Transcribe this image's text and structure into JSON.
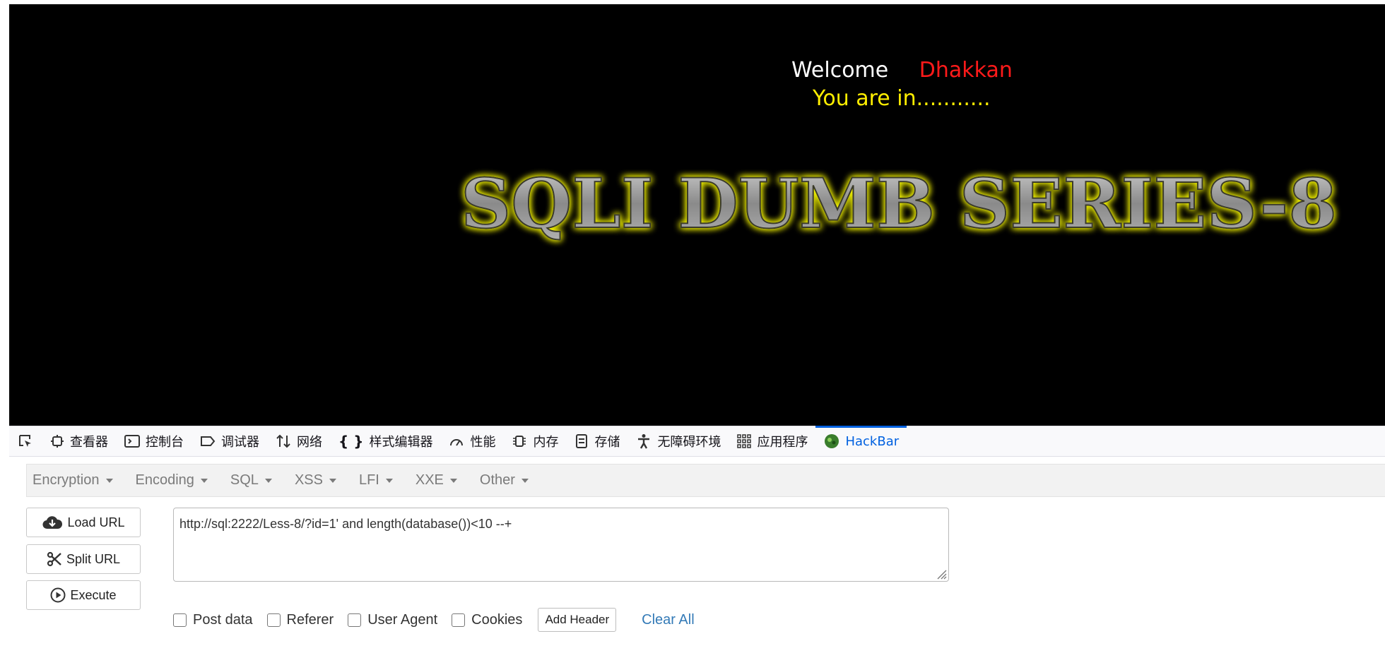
{
  "page": {
    "welcome_word": "Welcome",
    "welcome_name": "Dhakkan",
    "status_message": "You are in...........",
    "banner_text": "SQLI DUMB SERIES-8"
  },
  "devtools": {
    "tabs": [
      {
        "label": "查看器",
        "icon": "inspector-icon"
      },
      {
        "label": "控制台",
        "icon": "console-icon"
      },
      {
        "label": "调试器",
        "icon": "debugger-icon"
      },
      {
        "label": "网络",
        "icon": "network-icon"
      },
      {
        "label": "样式编辑器",
        "icon": "style-editor-icon"
      },
      {
        "label": "性能",
        "icon": "performance-icon"
      },
      {
        "label": "内存",
        "icon": "memory-icon"
      },
      {
        "label": "存储",
        "icon": "storage-icon"
      },
      {
        "label": "无障碍环境",
        "icon": "accessibility-icon"
      },
      {
        "label": "应用程序",
        "icon": "application-icon"
      },
      {
        "label": "HackBar",
        "icon": "hackbar-icon",
        "active": true
      }
    ]
  },
  "hackbar": {
    "menus": [
      "Encryption",
      "Encoding",
      "SQL",
      "XSS",
      "LFI",
      "XXE",
      "Other"
    ],
    "buttons": {
      "load_url": "Load URL",
      "split_url": "Split URL",
      "execute": "Execute"
    },
    "url_value": "http://sql:2222/Less-8/?id=1' and length(database())<10 --+",
    "options": [
      "Post data",
      "Referer",
      "User Agent",
      "Cookies"
    ],
    "add_header": "Add Header",
    "clear_all": "Clear All"
  },
  "colors": {
    "welcome_name": "#ff1a1a",
    "status_message": "#ffee00",
    "active_tab": "#0061e0",
    "link": "#337ab7"
  }
}
